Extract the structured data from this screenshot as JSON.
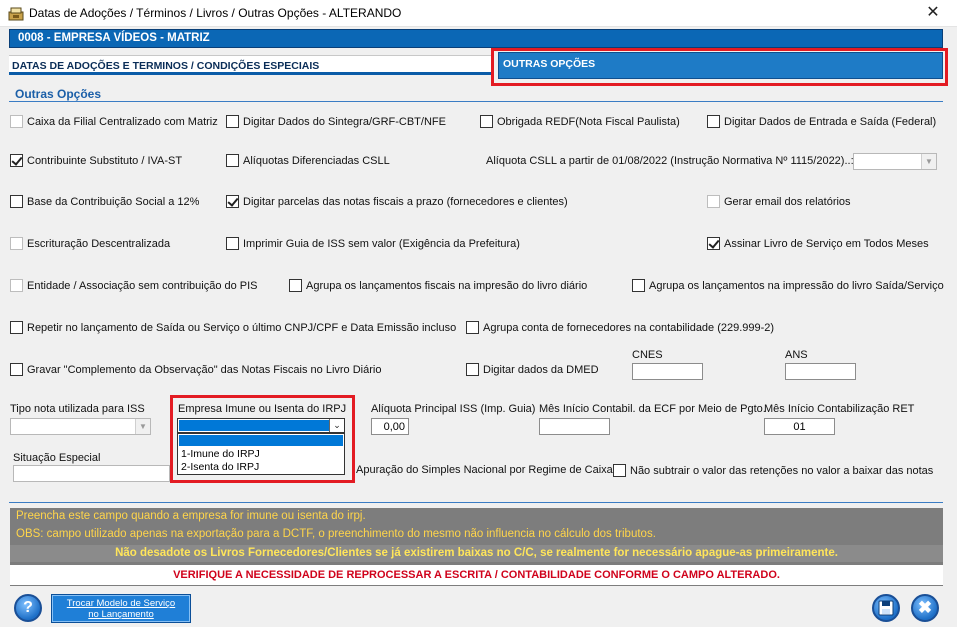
{
  "window": {
    "title": "Datas de Adoções / Términos / Livros / Outras Opções   -   ALTERANDO"
  },
  "company": {
    "label": "0008   -   EMPRESA VÍDEOS - MATRIZ"
  },
  "tabs": [
    {
      "label": "DATAS DE ADOÇÕES E TERMINOS / CONDIÇÕES ESPECIAIS"
    },
    {
      "label": "OUTRAS OPÇÕES"
    }
  ],
  "section": {
    "heading": "Outras Opções"
  },
  "checkboxes": {
    "caixa_filial": {
      "label": "Caixa da Filial Centralizado com Matriz",
      "checked": false,
      "enabled": false
    },
    "digitar_sintegra": {
      "label": "Digitar Dados do Sintegra/GRF-CBT/NFE",
      "checked": false
    },
    "obrigada_redf": {
      "label": "Obrigada REDF(Nota Fiscal Paulista)",
      "checked": false
    },
    "digitar_entrada_saida": {
      "label": "Digitar Dados de Entrada e Saída (Federal)",
      "checked": false
    },
    "contribuinte_substituto": {
      "label": "Contribuinte Substituto / IVA-ST",
      "checked": true
    },
    "aliquotas_csll": {
      "label": "Alíquotas Diferenciadas CSLL",
      "checked": false
    },
    "base_contribuicao": {
      "label": "Base da Contribuição Social a 12%",
      "checked": false
    },
    "digitar_parcelas": {
      "label": "Digitar parcelas das notas fiscais a prazo (fornecedores e clientes)",
      "checked": true
    },
    "gerar_email": {
      "label": "Gerar email dos relatórios",
      "checked": false,
      "enabled": false
    },
    "escrituracao": {
      "label": "Escrituração Descentralizada",
      "checked": false,
      "enabled": false
    },
    "imprimir_iss": {
      "label": "Imprimir Guia de ISS sem valor (Exigência da Prefeitura)",
      "checked": false
    },
    "assinar_livro": {
      "label": "Assinar Livro de Serviço em Todos Meses",
      "checked": true
    },
    "entidade": {
      "label": "Entidade / Associação sem contribuição do PIS",
      "checked": false,
      "enabled": false
    },
    "agrupa_diario": {
      "label": "Agrupa os lançamentos fiscais na impresão do livro diário",
      "checked": false
    },
    "agrupa_saida": {
      "label": "Agrupa os lançamentos na impressão do livro Saída/Serviço",
      "checked": false
    },
    "repetir_lancamento": {
      "label": "Repetir no lançamento de Saída ou Serviço o último CNPJ/CPF e Data Emissão incluso",
      "checked": false
    },
    "agrupa_fornecedores": {
      "label": "Agrupa conta de fornecedores na contabilidade (229.999-2)",
      "checked": false
    },
    "gravar_complemento": {
      "label": "Gravar \"Complemento da Observação\" das Notas Fiscais no Livro Diário",
      "checked": false
    },
    "digitar_dmed": {
      "label": "Digitar dados da DMED",
      "checked": false
    },
    "apuracao_simples": {
      "label": "Apuração do Simples Nacional por Regime de Caixa",
      "checked": false
    },
    "nao_subtrair": {
      "label": "Não subtrair o valor das retenções no valor a baixar das notas",
      "checked": false
    }
  },
  "fields": {
    "aliquota_csll": {
      "label": "Alíquota CSLL a partir de 01/08/2022 (Instrução Normativa Nº 1115/2022)..:",
      "value": ""
    },
    "cnes": {
      "label": "CNES",
      "value": ""
    },
    "ans": {
      "label": "ANS",
      "value": ""
    },
    "tipo_nota_iss": {
      "label": "Tipo nota utilizada para ISS",
      "value": ""
    },
    "empresa_imune": {
      "label": "Empresa Imune ou Isenta do IRPJ",
      "value": "",
      "options": [
        "1-Imune do IRPJ",
        "2-Isenta do IRPJ"
      ]
    },
    "aliquota_iss": {
      "label": "Alíquota Principal ISS (Imp. Guia)",
      "value": "0,00"
    },
    "mes_inicio_ecf": {
      "label": "Mês Início Contabil. da ECF por Meio de Pgto.",
      "value": ""
    },
    "mes_inicio_ret": {
      "label": "Mês Início Contabilização RET",
      "value": "01"
    },
    "situacao_especial": {
      "label": "Situação Especial",
      "value": ""
    }
  },
  "messages": {
    "line1": "Preencha este campo quando a empresa for imune ou isenta do irpj.",
    "line2": "OBS: campo utilizado apenas na exportação para a DCTF, o preenchimento do mesmo não influencia no cálculo dos tributos.",
    "line3": "Não desadote os Livros Fornecedores/Clientes se já existirem baixas no C/C, se realmente for necessário apague-as primeiramente.",
    "line4": "VERIFIQUE A NECESSIDADE DE REPROCESSAR A ESCRITA / CONTABILIDADE CONFORME O CAMPO ALTERADO."
  },
  "buttons": {
    "help": "?",
    "trocar_line1": "Trocar Modelo de Serviço",
    "trocar_line2": "no Lançamento",
    "save_icon": "save-icon",
    "close_icon": "close-icon"
  },
  "colors": {
    "accent": "#0b67b5",
    "highlight": "#e31b23",
    "warning_text": "#ffd54a",
    "error_text": "#d0021b"
  }
}
